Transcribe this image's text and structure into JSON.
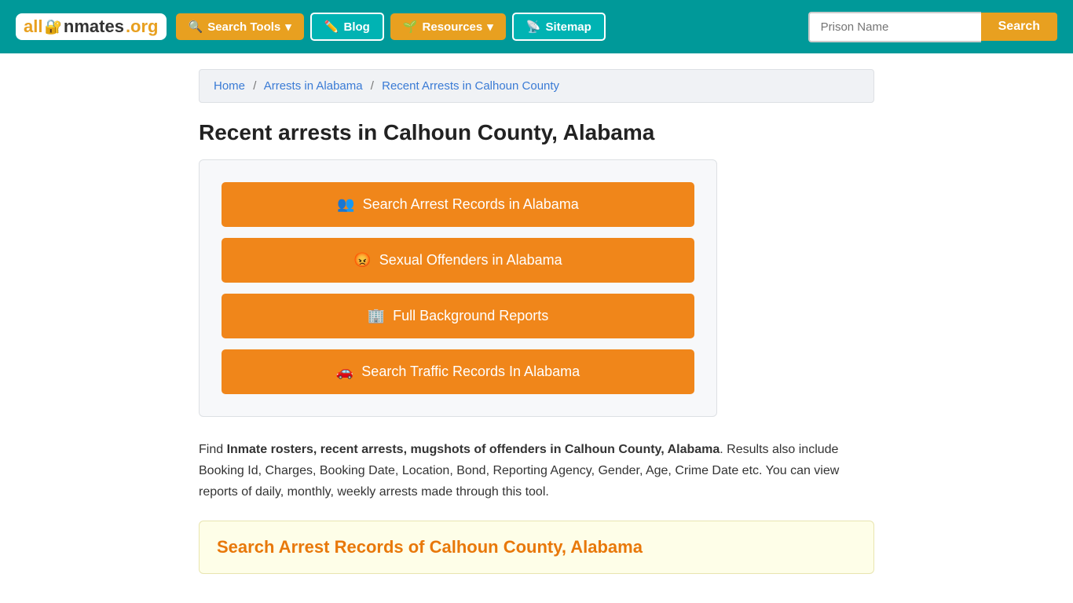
{
  "header": {
    "logo_all": "all",
    "logo_inmates": "Inmates",
    "logo_org": ".org",
    "nav": [
      {
        "id": "search-tools",
        "label": "Search Tools",
        "icon": "🔍",
        "dropdown": true
      },
      {
        "id": "blog",
        "label": "Blog",
        "icon": "✏️",
        "dropdown": false
      },
      {
        "id": "resources",
        "label": "Resources",
        "icon": "🌱",
        "dropdown": true
      },
      {
        "id": "sitemap",
        "label": "Sitemap",
        "icon": "📡",
        "dropdown": false
      }
    ],
    "search_placeholder": "Prison Name",
    "search_button": "Search"
  },
  "breadcrumb": {
    "home": "Home",
    "arrests_in_alabama": "Arrests in Alabama",
    "current": "Recent Arrests in Calhoun County"
  },
  "page_title": "Recent arrests in Calhoun County, Alabama",
  "buttons": [
    {
      "id": "arrest-records",
      "icon": "👥",
      "label": "Search Arrest Records in Alabama"
    },
    {
      "id": "sexual-offenders",
      "icon": "😡",
      "label": "Sexual Offenders in Alabama"
    },
    {
      "id": "background-reports",
      "icon": "🏢",
      "label": "Full Background Reports"
    },
    {
      "id": "traffic-records",
      "icon": "🚗",
      "label": "Search Traffic Records In Alabama"
    }
  ],
  "description": {
    "prefix": "Find ",
    "bold_text": "Inmate rosters, recent arrests, mugshots of offenders in Calhoun County, Alabama",
    "suffix": ". Results also include Booking Id, Charges, Booking Date, Location, Bond, Reporting Agency, Gender, Age, Crime Date etc. You can view reports of daily, monthly, weekly arrests made through this tool."
  },
  "search_section": {
    "title": "Search Arrest Records of Calhoun County, Alabama"
  }
}
